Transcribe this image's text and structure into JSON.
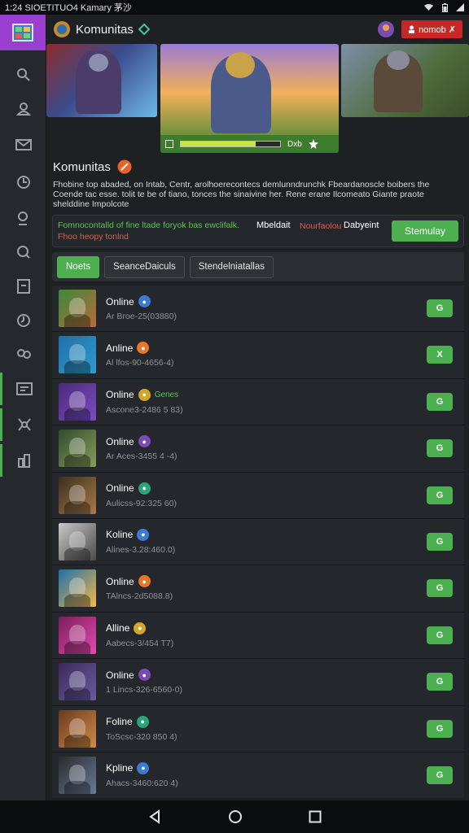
{
  "status_bar": {
    "time_text": "1:24 SIOETITUO4 Kamary 茅沙"
  },
  "header": {
    "title": "Komunitas",
    "report_label": "nomob ✗"
  },
  "banner": {
    "progress_label": "Dxb",
    "progress_fraction": 0.75
  },
  "section": {
    "title": "Komunitas",
    "description": "Fhobine top abaded, on Intab, Centr, arolhoerecontecs demlunndrunchk Fbeardanoscle boibers the Coende tac esse. tolit te be of tiano, tonces the sinaivine her. Rene erane Ilcomeato Giante praote shelddine Impolcote"
  },
  "promo": {
    "line1": "Fomnocontalld of fine ltade foryok bas ewclifalk.",
    "line2": "Fhoo heopy tonlnd",
    "mid_label": "Mbeldait",
    "mid_label_red": "Nourfaolou",
    "mid_label_right": "Dabyeint",
    "cta_label": "Stemulay"
  },
  "tabs": [
    {
      "label": "Noets",
      "active": true
    },
    {
      "label": "SeanceDaiculs",
      "active": false
    },
    {
      "label": "Stendelniatallas",
      "active": false
    }
  ],
  "members": [
    {
      "name": "Online",
      "extra": "",
      "sub": "Ar Broe-25(03880)",
      "button": "G",
      "palette": [
        "#3c8a3c",
        "#b86a3a"
      ]
    },
    {
      "name": "Anline",
      "extra": "",
      "sub": "Al lfos-90-4656-4)",
      "button": "X",
      "palette": [
        "#1f6fa8",
        "#2f9bd0"
      ]
    },
    {
      "name": "Online",
      "extra": "Genes",
      "sub": "Ascone3-2486 5 83)",
      "button": "G",
      "palette": [
        "#4b2a7a",
        "#7d4bc0"
      ]
    },
    {
      "name": "Online",
      "extra": "",
      "sub": "Ar Aces-3455 4 -4)",
      "button": "G",
      "palette": [
        "#2e4d2e",
        "#8a9a5a"
      ]
    },
    {
      "name": "Online",
      "extra": "",
      "sub": "Aulicss-92:325 60)",
      "button": "G",
      "palette": [
        "#3b2e1e",
        "#a87a4a"
      ]
    },
    {
      "name": "Koline",
      "extra": "",
      "sub": "Alines-3.28:460.0)",
      "button": "G",
      "palette": [
        "#c8c8c8",
        "#4a4a4a"
      ]
    },
    {
      "name": "Online",
      "extra": "",
      "sub": "TAlncs-2d5088.8)",
      "button": "G",
      "palette": [
        "#1e6fa8",
        "#f2b84a"
      ]
    },
    {
      "name": "Alline",
      "extra": "",
      "sub": "Aabecs-3/454 T7)",
      "button": "G",
      "palette": [
        "#7a1e5a",
        "#e24ab0"
      ]
    },
    {
      "name": "Online",
      "extra": "",
      "sub": "1 Lincs-326-6560-0)",
      "button": "G",
      "palette": [
        "#3a2a5a",
        "#6a5aa0"
      ]
    },
    {
      "name": "Foline",
      "extra": "",
      "sub": "ToScsc-320 850 4)",
      "button": "G",
      "palette": [
        "#6a3a1e",
        "#d08a4a"
      ]
    },
    {
      "name": "Kpline",
      "extra": "",
      "sub": "Ahacs-3460:620 4)",
      "button": "G",
      "palette": [
        "#2a2a2a",
        "#6a7a9a"
      ]
    }
  ],
  "colors": {
    "accent": "#4caf50",
    "danger": "#c62828",
    "logo_bg": "#9b3fd0",
    "background": "#1e2124"
  }
}
